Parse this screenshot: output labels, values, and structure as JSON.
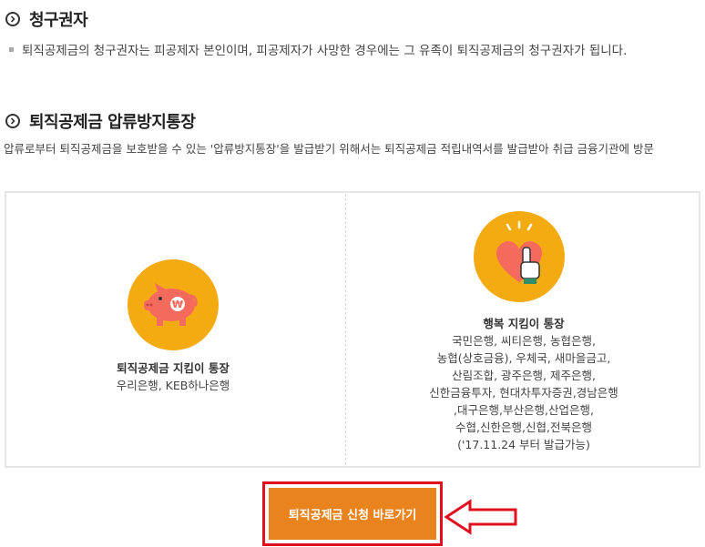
{
  "section1": {
    "title": "청구권자",
    "bullet": "퇴직공제금의 청구권자는 피공제자 본인이며, 피공제자가 사망한 경우에는 그 유족이 퇴직공제금의 청구권자가 됩니다."
  },
  "section2": {
    "title": "퇴직공제금 압류방지통장",
    "description": "압류로부터 퇴직공제금을 보호받을 수 있는 '압류방지통장'을 발급받기 위해서는 퇴직공제금 적립내역서를 발급받아 취급 금융기관에 방문"
  },
  "cards": [
    {
      "icon": "piggy-bank-icon",
      "title": "퇴직공제금 지킴이 통장",
      "lines": [
        "우리은행, KEB하나은행"
      ]
    },
    {
      "icon": "heart-hand-icon",
      "title": "행복 지킴이 통장",
      "lines": [
        "국민은행, 씨티은행, 농협은행,",
        "농협(상호금융), 우체국, 새마을금고,",
        "산림조합, 광주은행, 제주은행,",
        "신한금융투자, 현대차투자증권,경남은행",
        ",대구은행,부산은행,산업은행,",
        "수협,신한은행,신협,전북은행",
        "('17.11.24 부터 발급가능)"
      ]
    }
  ],
  "cta": {
    "label": "퇴직공제금 신청 바로가기"
  },
  "colors": {
    "accent_orange": "#e9831e",
    "icon_yellow": "#f4ab12",
    "highlight_red": "#e1101e",
    "coral": "#f46a5c"
  }
}
